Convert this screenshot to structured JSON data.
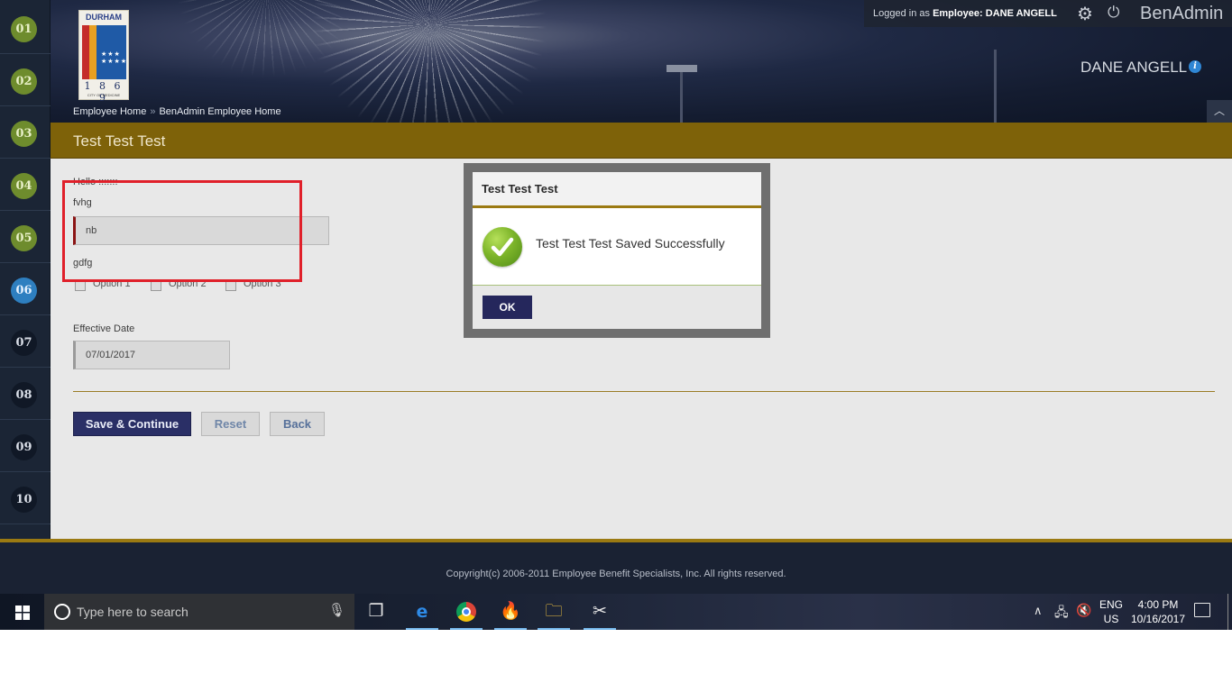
{
  "steps": [
    "01",
    "02",
    "03",
    "04",
    "05",
    "06",
    "07",
    "08",
    "09",
    "10"
  ],
  "header": {
    "logo": {
      "top_text": "DURHAM",
      "year": "1 8 6 9",
      "sub": "CITY OF MEDICINE"
    },
    "breadcrumb": {
      "home": "Employee Home",
      "sep": "»",
      "current": "BenAdmin Employee Home"
    },
    "login_prefix": "Logged in as",
    "login_role": "Employee:",
    "login_name": "DANE ANGELL",
    "brand": "BenAdmin",
    "user_display": "DANE ANGELL"
  },
  "page": {
    "title": "Test Test Test",
    "hello_label": "Hello :::::::",
    "field1_label": "fvhg",
    "field1_value": "nb",
    "field2_label": "gdfg",
    "options": [
      "Option 1",
      "Option 2",
      "Option 3"
    ],
    "date_label": "Effective Date",
    "date_value": "07/01/2017",
    "buttons": {
      "save": "Save & Continue",
      "reset": "Reset",
      "back": "Back"
    }
  },
  "modal": {
    "title": "Test Test Test",
    "message": "Test Test Test Saved Successfully",
    "ok": "OK"
  },
  "footer": {
    "copyright": "Copyright(c) 2006-2011 Employee Benefit Specialists, Inc. All rights reserved."
  },
  "taskbar": {
    "search_placeholder": "Type here to search",
    "lang_line1": "ENG",
    "lang_line2": "US",
    "time": "4:00 PM",
    "date": "10/16/2017"
  },
  "colors": {
    "title_bar": "#7e6209",
    "primary_button": "#2a2f66",
    "highlight_box": "#e0202a",
    "success": "#7db52a"
  }
}
